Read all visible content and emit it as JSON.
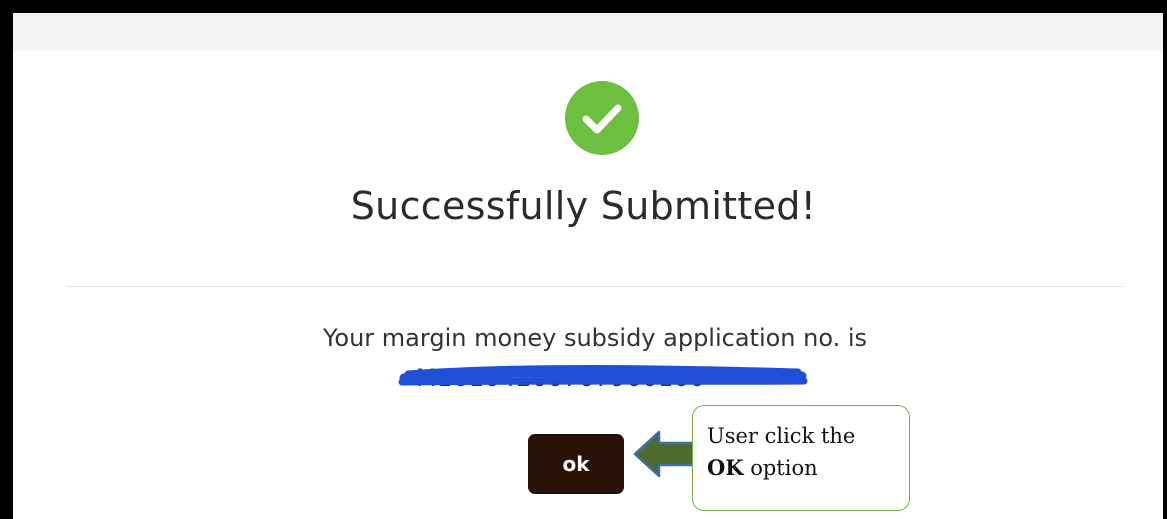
{
  "dialog": {
    "icon": "check-circle-icon",
    "title": "Successfully Submitted!",
    "message": "Your margin money subsidy application no. is",
    "application_no": "M10104200707900100",
    "ok_label": "ok"
  },
  "callout": {
    "line1": "User click the",
    "bold": "OK",
    "line2_rest": " option"
  },
  "colors": {
    "success": "#6cbf3f",
    "ok_button": "#2a1208",
    "redaction": "#1f4fd6",
    "arrow_fill": "#4e6b2f",
    "arrow_stroke": "#3d6ea6",
    "callout_border": "#76b244"
  }
}
